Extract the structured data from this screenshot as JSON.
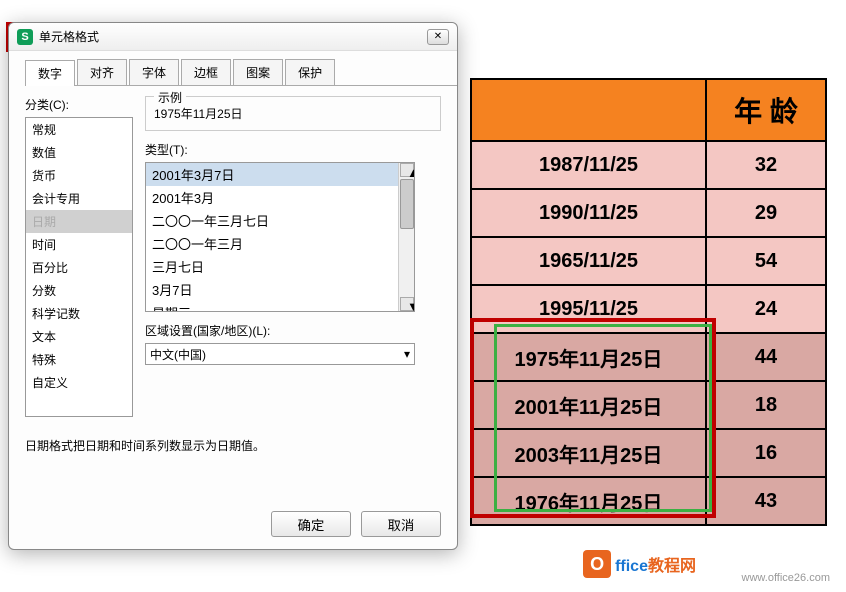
{
  "dialog": {
    "title": "单元格格式",
    "icon_letter": "S",
    "close_glyph": "✕",
    "tabs": [
      "数字",
      "对齐",
      "字体",
      "边框",
      "图案",
      "保护"
    ],
    "category_label": "分类(C):",
    "categories": [
      "常规",
      "数值",
      "货币",
      "会计专用",
      "日期",
      "时间",
      "百分比",
      "分数",
      "科学记数",
      "文本",
      "特殊",
      "自定义"
    ],
    "selected_category_index": 4,
    "example_label": "示例",
    "example_value": "1975年11月25日",
    "type_label": "类型(T):",
    "type_options": [
      "2001年3月7日",
      "2001年3月",
      "二〇〇一年三月七日",
      "二〇〇一年三月",
      "三月七日",
      "3月7日",
      "星期三"
    ],
    "selected_type_index": 0,
    "locale_label": "区域设置(国家/地区)(L):",
    "locale_value": "中文(中国)",
    "description": "日期格式把日期和时间系列数显示为日期值。",
    "ok_button": "确定",
    "cancel_button": "取消"
  },
  "sheet": {
    "header_age": "年 龄",
    "rows": [
      {
        "date": "1987/11/25",
        "age": "32"
      },
      {
        "date": "1990/11/25",
        "age": "29"
      },
      {
        "date": "1965/11/25",
        "age": "54"
      },
      {
        "date": "1995/11/25",
        "age": "24"
      },
      {
        "date": "1975年11月25日",
        "age": "44"
      },
      {
        "date": "2001年11月25日",
        "age": "18"
      },
      {
        "date": "2003年11月25日",
        "age": "16"
      },
      {
        "date": "1976年11月25日",
        "age": "43"
      }
    ]
  },
  "watermark_url": "www.office26.com",
  "logo_text_1": "ffice",
  "logo_text_2": "教程网"
}
